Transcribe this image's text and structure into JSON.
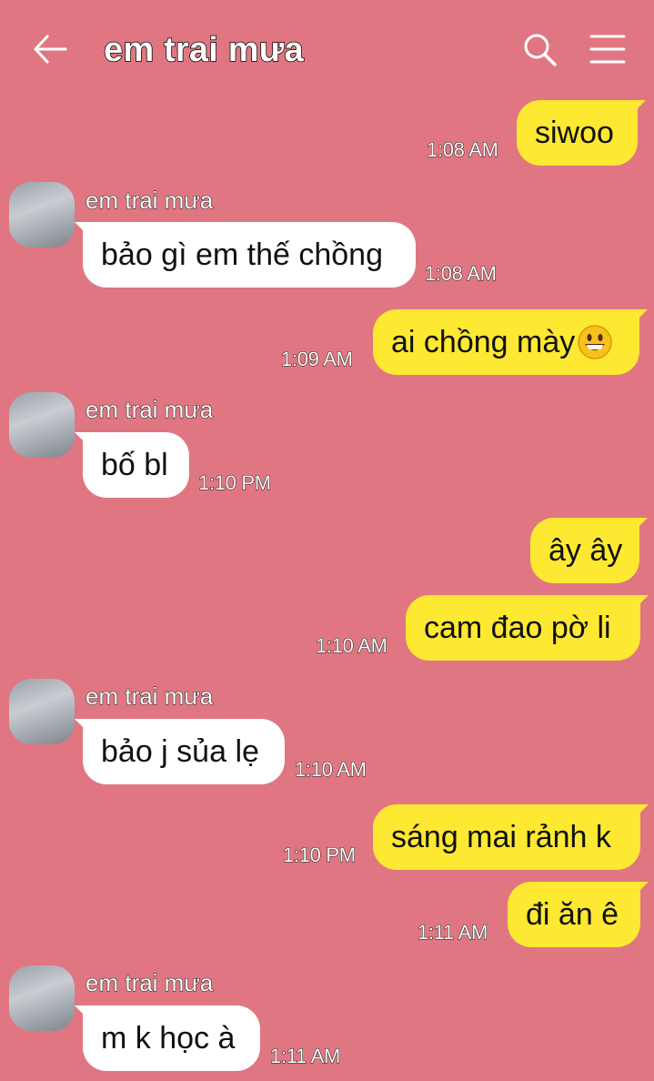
{
  "header": {
    "title": "em trai mưa",
    "icons": [
      "back-arrow-icon",
      "search-icon",
      "menu-icon"
    ]
  },
  "colors": {
    "background": "#e07681",
    "outgoing_bubble": "#fde832",
    "incoming_bubble": "#ffffff"
  },
  "messages": [
    {
      "direction": "out",
      "text": "siwoo",
      "time": "1:08 AM"
    },
    {
      "direction": "in",
      "sender": "em trai mưa",
      "text": "bảo gì em thế chồng",
      "time": "1:08 AM"
    },
    {
      "direction": "out",
      "text": "ai chồng mày",
      "emoji": "grinning-face",
      "time": "1:09 AM"
    },
    {
      "direction": "in",
      "sender": "em trai mưa",
      "text": "bố bl",
      "time": "1:10 PM"
    },
    {
      "direction": "out",
      "text": "ây ây"
    },
    {
      "direction": "out",
      "text": "cam đao pờ li",
      "time": "1:10 AM"
    },
    {
      "direction": "in",
      "sender": "em trai mưa",
      "text": "bảo j sủa lẹ",
      "time": "1:10 AM"
    },
    {
      "direction": "out",
      "text": "sáng mai rảnh k",
      "time": "1:10 PM"
    },
    {
      "direction": "out",
      "text": "đi ăn ê",
      "time": "1:11 AM"
    },
    {
      "direction": "in",
      "sender": "em trai mưa",
      "text": "m k học à",
      "time": "1:11 AM"
    }
  ]
}
